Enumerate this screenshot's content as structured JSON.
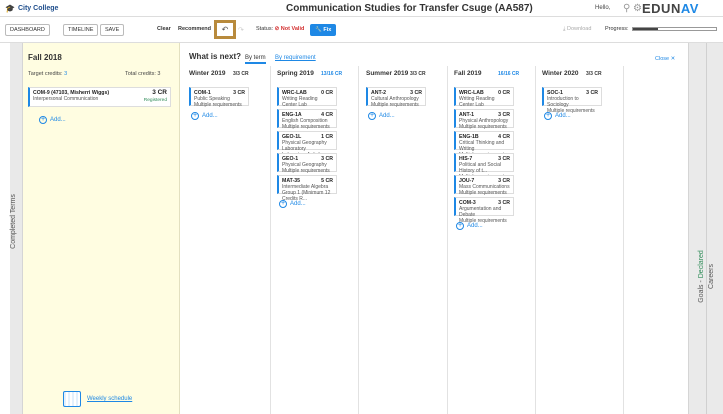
{
  "header": {
    "college": "City College",
    "title": "Communication Studies for Transfer Csuge (AA587)",
    "hello": "Hello,",
    "logo_main": "EDUN",
    "logo_accent": "AV"
  },
  "toolbar": {
    "dashboard": "DASHBOARD",
    "timeline": "TIMELINE",
    "save": "SAVE",
    "clear": "Clear",
    "recommend": "Recommend",
    "status_label": "Status:",
    "status_value": "Not Valid",
    "fix": "Fix",
    "download": "Download",
    "progress_label": "Progress:",
    "progress_fraction": 0.3
  },
  "left_rail": {
    "label": "Completed Terms"
  },
  "completed": {
    "term": "Fall 2018",
    "target_label": "Target credits:",
    "target_value": "3",
    "total_label": "Total credits:",
    "total_value": "3",
    "course": {
      "code": "COM-9 (47103, Misherri Wiggs)",
      "desc": "Interpersonal Communication",
      "cr": "3 CR",
      "status": "Registered"
    },
    "add": "Add...",
    "weekly": "Weekly schedule"
  },
  "planner": {
    "heading": "What is next?",
    "tab_term": "By term",
    "tab_req": "By requirement",
    "close": "Close"
  },
  "columns": [
    {
      "term": "Winter 2019",
      "cr_a": "3",
      "cr_b": "/3 CR",
      "blue": false,
      "courses": [
        {
          "code": "COM-1",
          "cr": "3 CR",
          "desc": "Public Speaking",
          "desc2": "Multiple requirements"
        }
      ]
    },
    {
      "term": "Spring 2019",
      "cr_a": "13",
      "cr_b": "/16 CR",
      "blue": true,
      "courses": [
        {
          "code": "WRC-LAB",
          "cr": "0 CR",
          "desc": "Writing Reading Center Lab",
          "desc2": ""
        },
        {
          "code": "ENG-1A",
          "cr": "4 CR",
          "desc": "English Composition",
          "desc2": "Multiple requirements"
        },
        {
          "code": "GEO-1L",
          "cr": "1 CR",
          "desc": "Physical Geography Laboratory",
          "desc2": "Laboratory Activity"
        },
        {
          "code": "GEO-1",
          "cr": "3 CR",
          "desc": "Physical Geography",
          "desc2": "Multiple requirements"
        },
        {
          "code": "MAT-35",
          "cr": "5 CR",
          "desc": "Intermediate Algebra",
          "desc2": "Group 1 (Minimum 12 Credits R..."
        }
      ]
    },
    {
      "term": "Summer 2019",
      "cr_a": "3",
      "cr_b": "/3 CR",
      "blue": false,
      "courses": [
        {
          "code": "ANT-2",
          "cr": "3 CR",
          "desc": "Cultural Anthropology",
          "desc2": "Multiple requirements"
        }
      ]
    },
    {
      "term": "Fall 2019",
      "cr_a": "16",
      "cr_b": "/16 CR",
      "blue": true,
      "courses": [
        {
          "code": "WRC-LAB",
          "cr": "0 CR",
          "desc": "Writing Reading Center Lab",
          "desc2": ""
        },
        {
          "code": "ANT-1",
          "cr": "3 CR",
          "desc": "Physical Anthropology",
          "desc2": "Multiple requirements"
        },
        {
          "code": "ENG-1B",
          "cr": "4 CR",
          "desc": "Critical Thinking and Writing",
          "desc2": "Multiple requirements"
        },
        {
          "code": "HIS-7",
          "cr": "3 CR",
          "desc": "Political and Social History of t...",
          "desc2": "Multiple requirements"
        },
        {
          "code": "JOU-7",
          "cr": "3 CR",
          "desc": "Mass Communications",
          "desc2": "Multiple requirements"
        },
        {
          "code": "COM-3",
          "cr": "3 CR",
          "desc": "Argumentation and Debate",
          "desc2": "Multiple requirements"
        }
      ]
    },
    {
      "term": "Winter 2020",
      "cr_a": "3",
      "cr_b": "/3 CR",
      "blue": false,
      "courses": [
        {
          "code": "SOC-1",
          "cr": "3 CR",
          "desc": "Introduction to Sociology",
          "desc2": "Multiple requirements"
        }
      ]
    }
  ],
  "right_rail": {
    "goals": "Goals -",
    "declared": "Declared",
    "careers": "Careers"
  }
}
